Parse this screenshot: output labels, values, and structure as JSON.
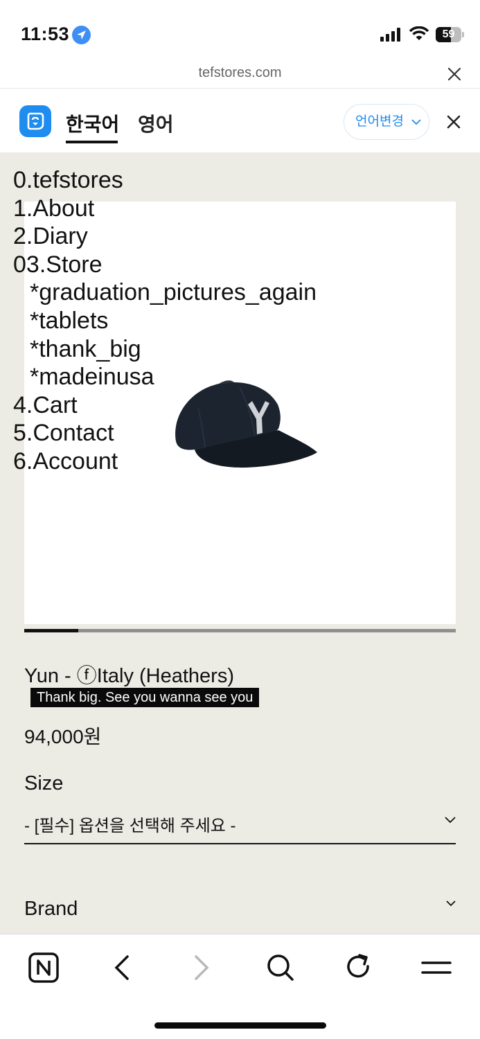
{
  "status_bar": {
    "time": "11:53",
    "battery": "59",
    "battery_level": 0.59,
    "icons": [
      "location-arrow-icon",
      "signal-icon",
      "wifi-icon",
      "battery-icon"
    ]
  },
  "browser": {
    "url": "tefstores.com"
  },
  "translate_bar": {
    "tab_korean": "한국어",
    "tab_english": "영어",
    "change_language": "언어변경",
    "accent": "#1f8cf0"
  },
  "nav": {
    "items": [
      {
        "label": "0.tefstores"
      },
      {
        "label": "1.About"
      },
      {
        "label": "2.Diary"
      },
      {
        "label": "03.Store"
      },
      {
        "label": "*graduation_pictures_again"
      },
      {
        "label": "*tablets"
      },
      {
        "label": "*thank_big"
      },
      {
        "label": "*madeinusa"
      },
      {
        "label": "4.Cart"
      },
      {
        "label": "5.Contact"
      },
      {
        "label": "6.Account"
      }
    ]
  },
  "product": {
    "title": "Yun - ⓕItaly (Heathers)",
    "tagline": "Thank big. See you wanna see you",
    "price": "94,000원",
    "image_progress": 0.125,
    "size_label": "Size",
    "size_placeholder": "- [필수] 옵션을 선택해 주세요 -",
    "brand_label": "Brand"
  },
  "toolbar": {
    "icons": [
      "naver-home-icon",
      "back-icon",
      "forward-icon",
      "search-icon",
      "reload-icon",
      "menu-icon"
    ]
  },
  "colors": {
    "page_background": "#ecebe4",
    "accent": "#1f8cf0"
  }
}
